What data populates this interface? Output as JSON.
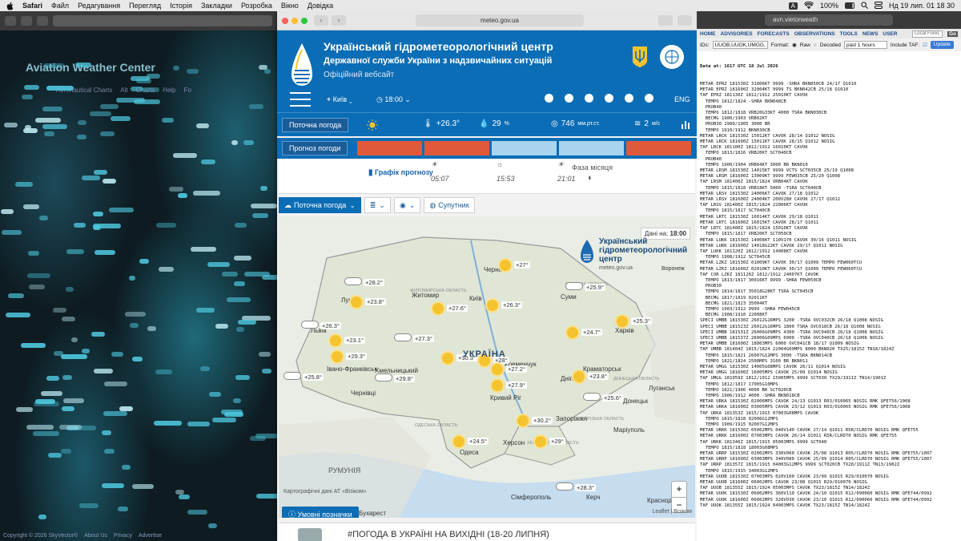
{
  "menubar": {
    "app": "Safari",
    "items": [
      "Файл",
      "Редагування",
      "Перегляд",
      "Історія",
      "Закладки",
      "Розробка",
      "Вікно",
      "Довідка"
    ],
    "battery": "100%",
    "datetime": "Нд 19 лип.  01 18 30",
    "input_lang": "A"
  },
  "left": {
    "title": "Aviation Weather Center",
    "nav": [
      "Aeronautical Charts",
      "Alt",
      "Charts",
      "Help",
      "Fo"
    ],
    "footer": [
      "Copyright © 2026 SkyVector®",
      "About Us",
      "Privacy",
      "Advertise"
    ]
  },
  "center": {
    "url": "meteo.gov.ua",
    "org_title": "Український гідрометеорологічний центр",
    "org_subtitle": "Державної служби України з надзвичайних ситуацій",
    "official": "Офіційний вебсайт",
    "city": "Київ",
    "time": "18:00",
    "lang": "ENG",
    "current_label": "Поточна погода",
    "current": {
      "temp": "+26.3°",
      "humidity": "29",
      "humidity_unit": "%",
      "pressure": "746",
      "pressure_unit": "мм.рт.ст.",
      "wind": "2",
      "wind_unit": "м/с"
    },
    "forecast_label": "Прогноз погоди",
    "forecast_colors": [
      "#e05a3a",
      "#e05a3a",
      "#a9d4ee",
      "#a9d4ee",
      "#e05a3a"
    ],
    "graph_label": "Графік прогнозу",
    "sunrise": "05:07",
    "daylength": "15:53",
    "sunset": "21:01",
    "moon_label": "Фаза місяця",
    "tabs": [
      "Поточна погода",
      "",
      "",
      "Супутник"
    ],
    "data_for_label": "Дані на:",
    "data_for_time": "18:00",
    "map_logo": {
      "l1": "Український",
      "l2": "гідрометеорологічний",
      "l3": "центр",
      "url": "meteo.gov.ua"
    },
    "country": "УКРАЇНА",
    "neighbors": {
      "romania": "РУМУНІЯ",
      "voronezh": "Воронеж"
    },
    "regions": [
      {
        "name": "СУМСЬКА ОБЛАСТЬ"
      },
      {
        "name": "ЖИТОМИРСЬКА ОБЛАСТЬ"
      },
      {
        "name": "ОДЕСЬКА ОБЛАСТЬ"
      },
      {
        "name": "ХЕРСОНСЬКА ОБЛАСТЬ"
      },
      {
        "name": "ЗАПОРІЗЬКА ОБЛАСТЬ"
      },
      {
        "name": "ДОНЕЦЬКА ОБЛАСТЬ"
      }
    ],
    "cities": [
      "Чернігів",
      "Суми",
      "Житомир",
      "Київ",
      "Луцьк",
      "Львів",
      "Хмельницький",
      "Чернівці",
      "Кременчук",
      "Дніпро",
      "Краматорськ",
      "Луганськ",
      "Харків",
      "Кривий Ріг",
      "Запоріжжя",
      "Донецьк",
      "Маріуполь",
      "Одеса",
      "Херсон",
      "Сімферополь",
      "Керч",
      "Івано-Франківськ",
      "Бухарест",
      "Краснодар"
    ],
    "temps": [
      "+28.2°",
      "+23.8°",
      "+27.6°",
      "+26.3°",
      "+27°",
      "+25.9°",
      "+25.3°",
      "+26.3°",
      "+23.1°",
      "+29.3°",
      "+27.3°",
      "+24.7°",
      "+30.3°",
      "+28°",
      "+27.2°",
      "+25.8°",
      "+29.8°",
      "+27.9°",
      "+23.8°",
      "+25.6°",
      "+30.2°",
      "+24.5°",
      "+29°",
      "+28.3°"
    ],
    "attribution": "Картографічні дані АТ «Візіком»",
    "attribution2": "Leaflet | Візіком",
    "legend": "Умовні позначки",
    "news": "#ПОГОДА В УКРАЇНІ НА ВИХІДНІ (18-20 ЛИПНЯ)"
  },
  "right": {
    "url": "avn.vietorweath",
    "nav": [
      "HOME",
      "ADVISORIES",
      "FORECASTS",
      "OBSERVATIONS",
      "TOOLS",
      "NEWS",
      "USER"
    ],
    "search": "Local Forec",
    "ids_label": "IDs:",
    "ids_value": "UUOB,UUOK,UMGG,",
    "go": "Go",
    "format_label": "Format:",
    "raw": "Raw",
    "decoded": "Decoded",
    "hours": "past 1 hours",
    "include_taf": "Include TAF:",
    "update": "Update",
    "data_at": "Data at: 1617 UTC 18 Jul 2026",
    "lines": [
      "METAR EPRZ 181530Z 31006KT 9999 -SHRA BKN050CB 24/17 Q1010",
      "METAR EPRZ 181600Z 32004KT 9999 TS BKN042CB 25/18 Q1010",
      "TAF EPRZ 181130Z 1812/1912 25010KT CAVOK",
      "  TEMPO 1812/1824 -SHRA BKN048CB",
      "  PROB40",
      "  TEMPO 1812/1818 VRB20G33KT 4000 TSRA BKN030CB",
      "  BECMG 1900/1903 VRB02KT",
      "  PROB30 1900/1905 3000 BR",
      "  TEMPO 1910/1912 BKN030CB",
      "METAR LRCK 181530Z 15012KT CAVOK 28/14 Q1012 NOSIG",
      "METAR LRCK 181600Z 15011KT CAVOK 28/15 Q1012 NOSIG",
      "TAF LRCK 181100Z 1812/1912 16010KT CAVOK",
      "  TEMPO 1813/1816 VRB20KT SCT040CB",
      "  PROB40",
      "  TEMPO 1900/1904 VRB04KT 3000 BR BKN010",
      "METAR LRSM 181530Z 14015KT 9999 VCTS SCT035CB 25/19 Q1008",
      "METAR LRSM 181600Z 13009KT 9999 FEW035CB 25/20 Q1008",
      "TAF LRSM 181400Z 1815/1824 VRB04KT CAVOK",
      "  TEMPO 1815/1818 VRB18KT 5000 -TSRA SCT040CB",
      "METAR LRSV 181530Z 24006KT CAVOK 27/18 Q1012",
      "METAR LRSV 181600Z 24004KT 200V280 CAVOK 27/17 Q1012",
      "TAF LRSV 181400Z 1815/1824 22006KT CAVOK",
      "  TEMPO 1815/1817 SCT040CB",
      "METAR LRTC 181530Z 16014KT CAVOK 29/18 Q1011",
      "METAR LRTC 181600Z 16015KT CAVOK 28/17 Q1011",
      "TAF LRTC 181400Z 1815/1824 15010KT CAVOK",
      "  TEMPO 1815/1817 VRB20KT SCT050CB",
      "METAR LUKK 181530Z 14008KT 110V170 CAVOK 30/16 Q1011 NOSIG",
      "METAR LUKK 181600Z 14018G22KT CAVOK 29/17 Q1011 NOSIG",
      "TAF LUKK 181120Z 1812/1912 14008KT CAVOK",
      "  TEMPO 1908/1912 SCT045CB",
      "METAR LZKZ 181530Z 01009KT CAVOK 30/17 Q1009 TEMPO FEW060TCU",
      "METAR LZKZ 181600Z 02010KT CAVOK 30/17 Q1009 TEMPO FEW060TCU",
      "TAF COR LZKZ 181126Z 1812/1912 24007KT CAVOK",
      "  TEMPO 1813/1817 30016KT 9999 -SHRA FEW050CB",
      "  PROB30",
      "  TEMPO 1814/1817 35018G28KT TSRA SCT045CB",
      "  BECMG 1817/1819 02011KT",
      "  BECMG 1821/1823 35004KT",
      "  TEMPO 1903/1912 9999 -SHRA FEW045CB",
      "  BECMG 1908/1910 22008KT",
      "SPECI UMBB 181530Z 26012G16MPS 3200 -TSRA OVC032CB 26/18 Q1008 NOSIG",
      "SPECI UMBB 181523Z 26012G16MPS 1800 TSRA OVC018CB 26/18 Q1008 NOSIG",
      "SPECI UMBB 181531Z 26006G09MPS 4300 -TSRA OVC040CB 26/18 Q1008 NOSIG",
      "SPECI UMBB 181537Z 26006G09MPS 6000 -TSRA OVC040CB 26/18 Q1008 NOSIG",
      "METAR UMBB 181600Z 18003MPS 6000 OVC041CB 18/17 Q1009 NOSIG",
      "TAF UMBB 181404Z 1815/1824 22004G09MPS 8000 BKN020 TX25/1815Z TN18/1824Z",
      "  TEMPO 1815/1821 26007G12MPS 3000 -TSRA BKN014CB",
      "  TEMPO 1821/1824 2500MPS 3100 BR BKN011",
      "METAR UMGG 181530Z 14005G08MPS CAVOK 26/11 Q1014 NOSIG",
      "METAR UMGG 181600Z 16005MPS CAVOK 25/09 Q1014 NOSIG",
      "TAF UMGG 181059Z 1812/1912 15005MPS 9999 SCT030 TX29/1911Z TN14/1901Z",
      "  TEMPO 1812/1817 17005G10MPS",
      "  TEMPO 1821/1906 4000 BR SCT020CB",
      "  TEMPO 1906/1912 4000 -SHRA BKN018CB",
      "METAR URKA 181530Z 02006MPS CAVOK 24/13 Q1013 R03/010065 NOSIG RMK QFE756/1008",
      "METAR URKA 181600Z 03005MPS CAVOK 23/12 Q1013 R03/010065 NOSIG RMK QFE756/1008",
      "TAF URKA 181353Z 1815/1915 07003G08MPS CAVOK",
      "  TEMPO 1815/1818 02006G12MPS",
      "  TEMPO 1909/1915 02007G12MPS",
      "METAR URKK 181530Z 05002MPS 040V140 CAVOK 27/14 Q1011 R5R/CLRD70 NOSIG RMK QFE755",
      "METAR URKK 181600Z 07003MPS CAVOK 26/14 Q1011 R5R/CLRD70 NOSIG RMK QFE755",
      "TAF URKK 181346Z 1815/1915 05003MPS 9999 SCT040",
      "  TEMPO 1815/1818 18003G08MPS",
      "METAR URRP 181530Z 02002MPS 330V060 CAVOK 25/08 Q1013 R05/CLRD70 NOSIG RMK QFE755/1007",
      "METAR URRP 181600Z 03003MPS 340V080 CAVOK 25/09 Q1014 R05/CLRD70 NOSIG RMK QFE755/1007",
      "TAF URRP 181357Z 1815/1915 04003G12MPS 9999 SCT020CB TX28/1911Z TN13/1902Z",
      "  TEMPO 1815/1915 34003G12MPS",
      "METAR UUOB 181530Z 07003MPS 020V100 CAVOK 23/09 Q1015 R29/010070 NOSIG",
      "METAR UUOB 181600Z 06002MPS CAVOK 23/08 Q1015 R29/010070 NOSIG",
      "TAF UUOB 181355Z 1815/1924 05003MPS CAVOK TX23/1815Z TN14/1824Z",
      "METAR UUOK 181530Z 06002MPS 360V110 CAVOK 24/10 Q1015 R12/090060 NOSIG RMK QFE744/0992",
      "METAR UUOK 181600Z 06002MPS 320V030 CAVOK 23/10 Q1015 R12/090060 NOSIG RMK QFE744/0992",
      "TAF UUOK 181355Z 1815/1924 04003MPS CAVOK TX23/1815Z TN14/1824Z"
    ]
  }
}
